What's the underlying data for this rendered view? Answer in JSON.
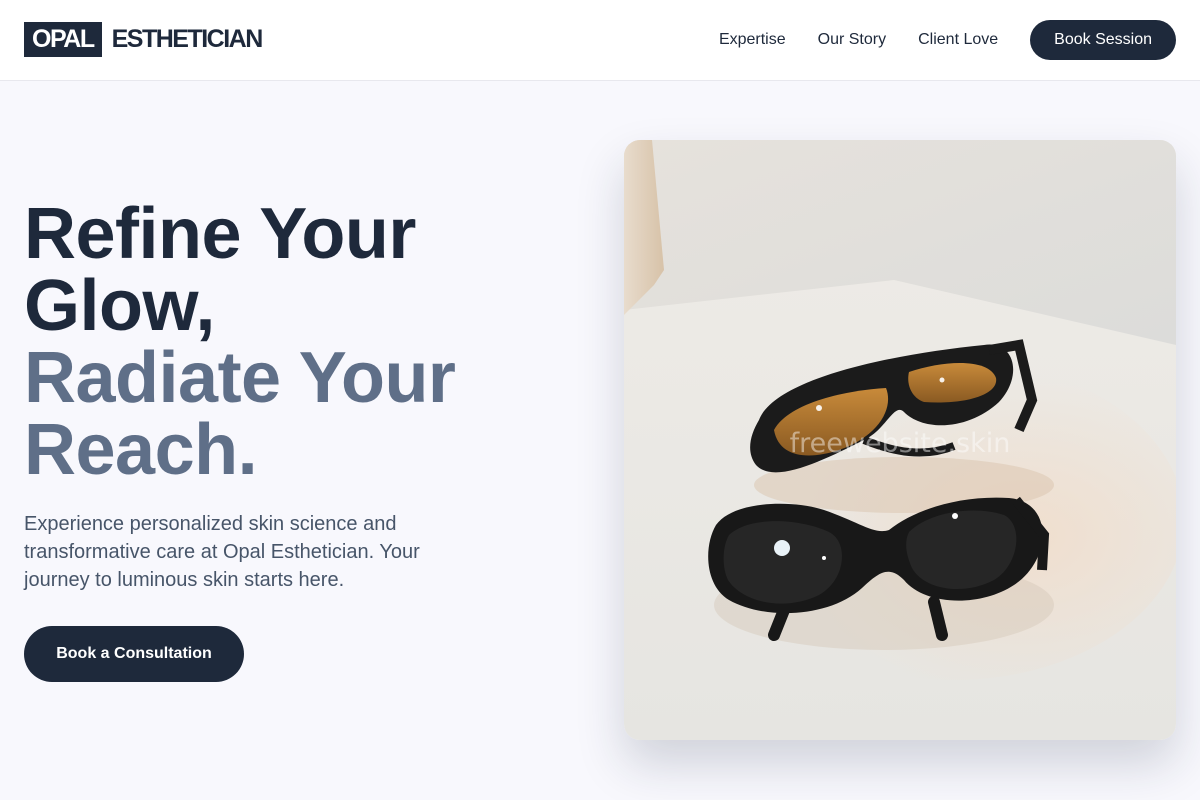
{
  "brand": {
    "box_text": "OPAL",
    "word": "ESTHETICIAN"
  },
  "nav": {
    "links": [
      "Expertise",
      "Our Story",
      "Client Love"
    ],
    "cta": "Book Session"
  },
  "hero": {
    "title_lines": [
      "Refine Your",
      "Glow,",
      "Radiate Your",
      "Reach."
    ],
    "subtitle": "Experience personalized skin science and transformative care at Opal Esthetician. Your journey to luminous skin starts here.",
    "cta": "Book a Consultation",
    "image_watermark": "freewebsite.skin"
  },
  "colors": {
    "primary": "#1e293b",
    "muted": "#5f6f88",
    "text": "#475569",
    "background": "#f8f8fd"
  }
}
